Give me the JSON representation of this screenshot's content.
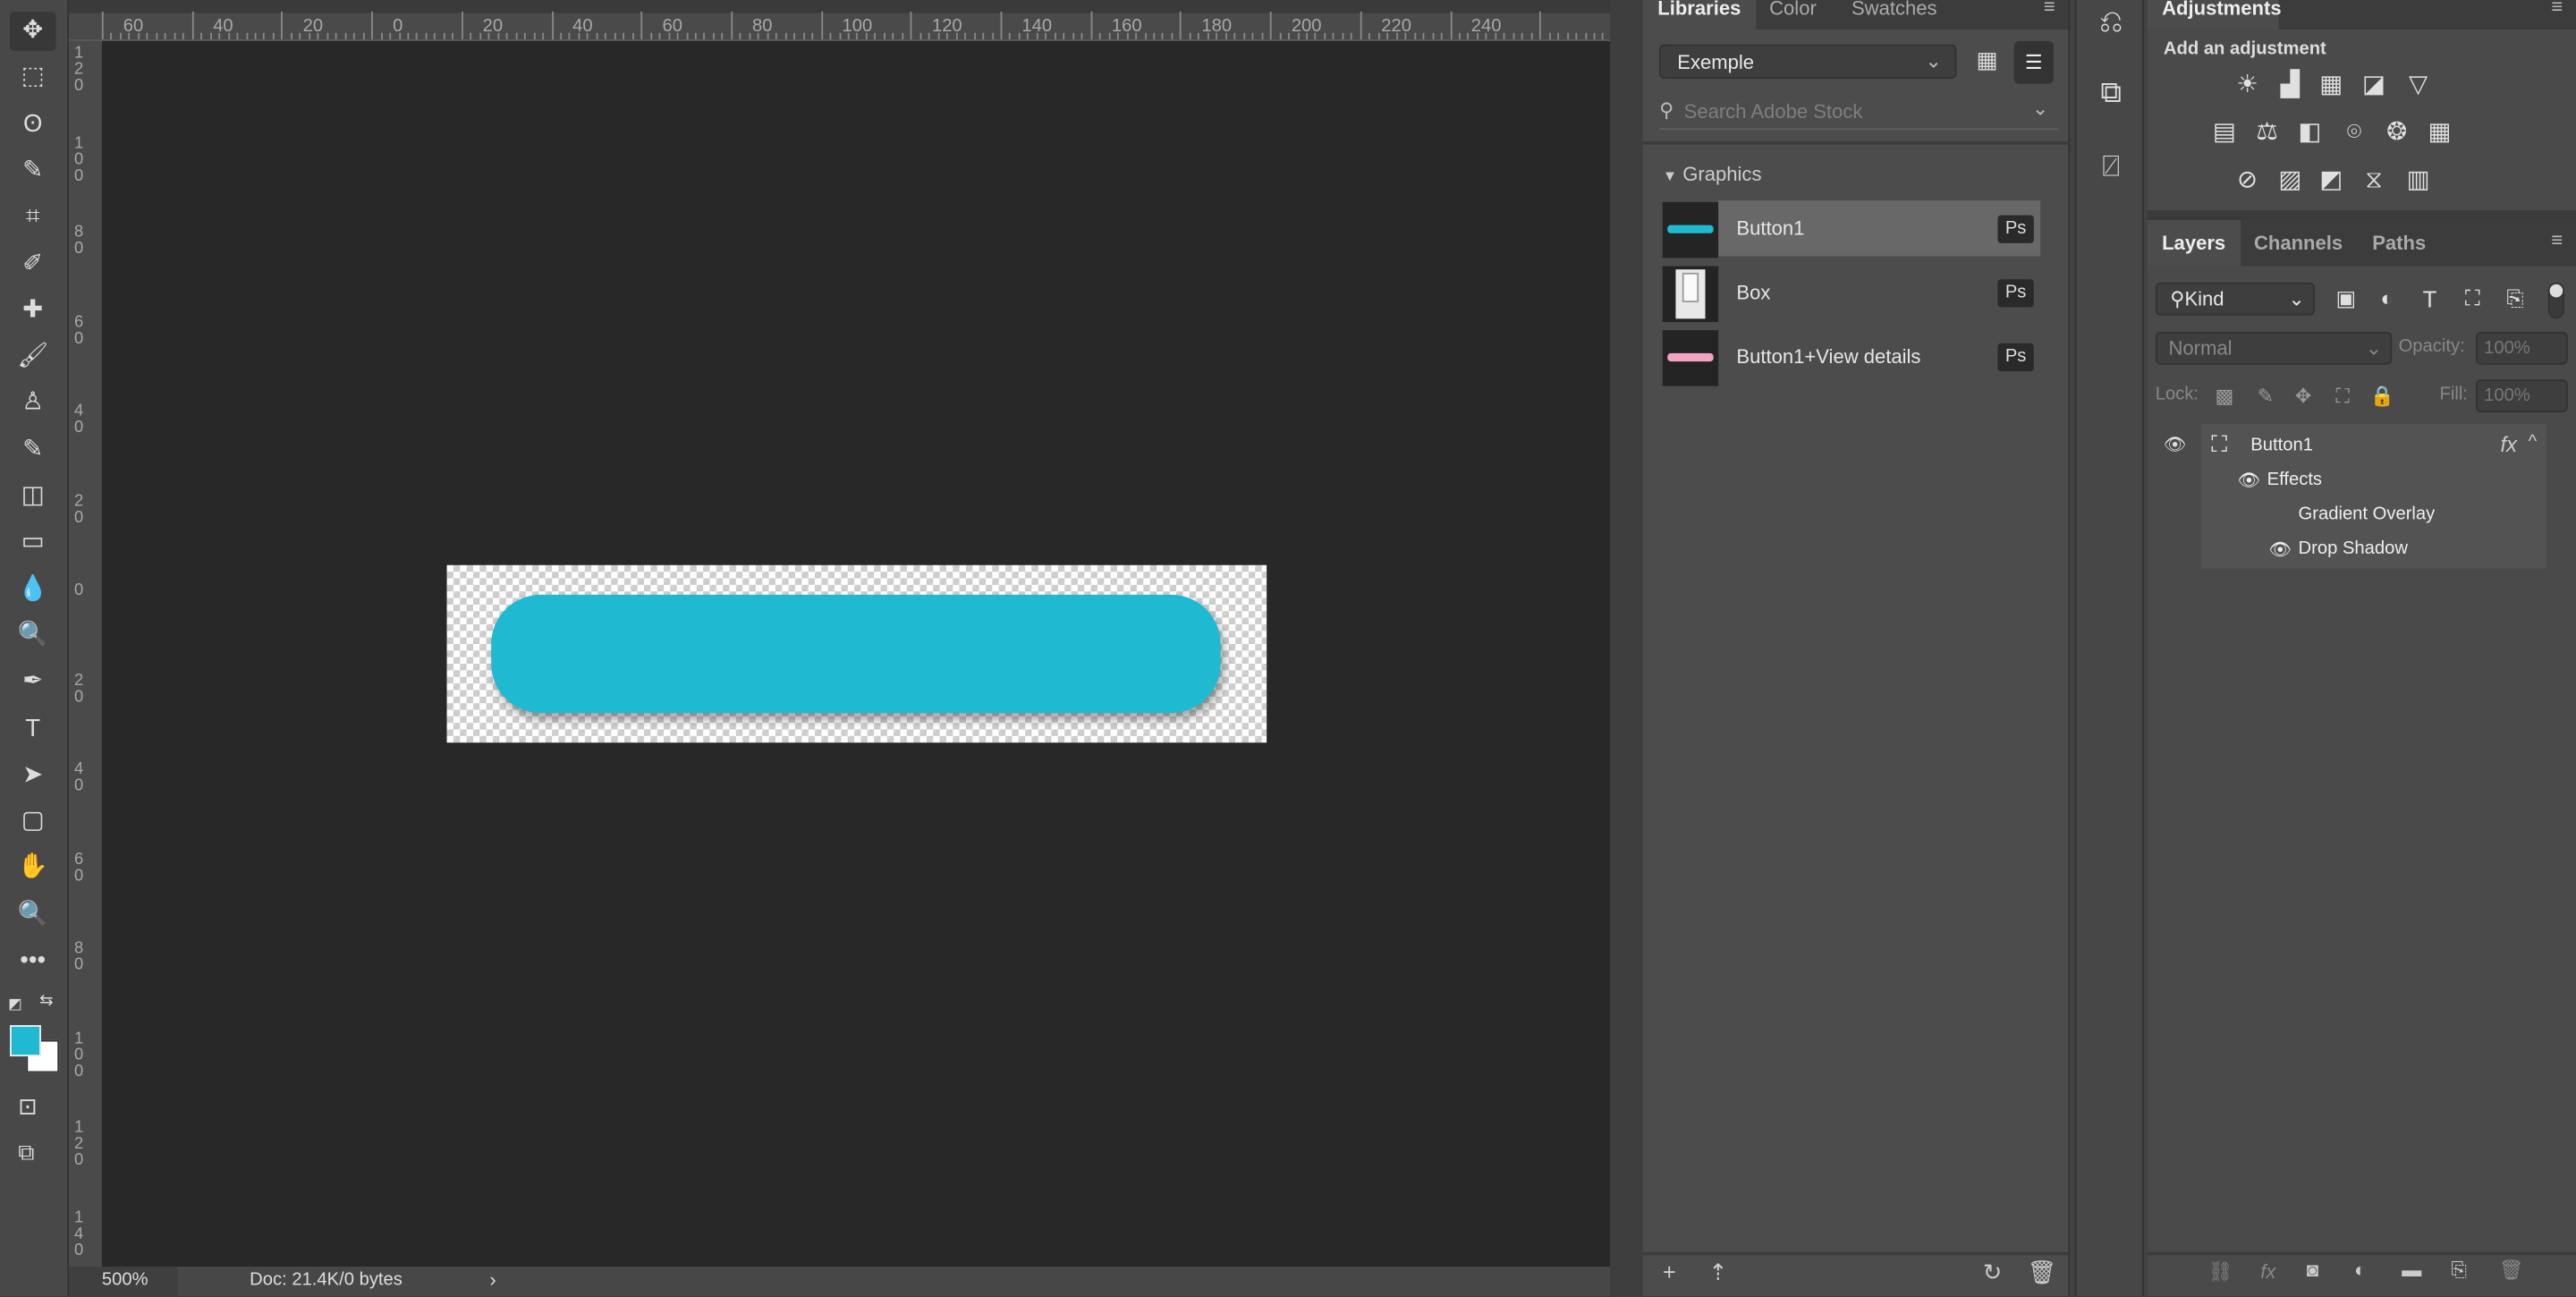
{
  "toolbar": {
    "tools": [
      "move-tool",
      "rectangular-marquee-tool",
      "lasso-tool",
      "quick-selection-tool",
      "crop-tool",
      "eyedropper-tool",
      "healing-brush-tool",
      "brush-tool",
      "clone-stamp-tool",
      "history-brush-tool",
      "eraser-tool",
      "gradient-tool",
      "blur-tool",
      "dodge-tool",
      "pen-tool",
      "type-tool",
      "path-selection-tool",
      "rectangle-tool",
      "hand-tool",
      "zoom-tool",
      "more-tools"
    ],
    "foreground_color": "#1fbad2",
    "background_color": "#ffffff"
  },
  "rulers": {
    "horizontal": [
      "60",
      "40",
      "20",
      "0",
      "20",
      "40",
      "60",
      "80",
      "100",
      "120",
      "140",
      "160",
      "180",
      "200",
      "220",
      "240"
    ],
    "vertical": [
      "120",
      "100",
      "80",
      "60",
      "40",
      "20",
      "0",
      "20",
      "40",
      "60",
      "80",
      "100",
      "120",
      "140"
    ]
  },
  "canvas": {
    "button_color": "#1fbad2"
  },
  "status": {
    "zoom": "500%",
    "doc": "Doc: 21.4K/0 bytes"
  },
  "libraries": {
    "tabs": [
      "Libraries",
      "Color",
      "Swatches"
    ],
    "library": "Exemple",
    "search_placeholder": "Search Adobe Stock",
    "section": "Graphics",
    "items": [
      {
        "label": "Button1",
        "badge": "Ps"
      },
      {
        "label": "Box",
        "badge": "Ps"
      },
      {
        "label": "Button1+View details",
        "badge": "Ps"
      }
    ]
  },
  "adjustments": {
    "tab": "Adjustments",
    "heading": "Add an adjustment"
  },
  "layers": {
    "tabs": [
      "Layers",
      "Channels",
      "Paths"
    ],
    "filter": "Kind",
    "blend_mode": "Normal",
    "opacity_label": "Opacity:",
    "opacity": "100%",
    "lock_label": "Lock:",
    "fill_label": "Fill:",
    "fill": "100%",
    "layer": {
      "name": "Button1",
      "fx": "fx",
      "effects_label": "Effects",
      "effects": [
        "Gradient Overlay",
        "Drop Shadow"
      ]
    }
  }
}
